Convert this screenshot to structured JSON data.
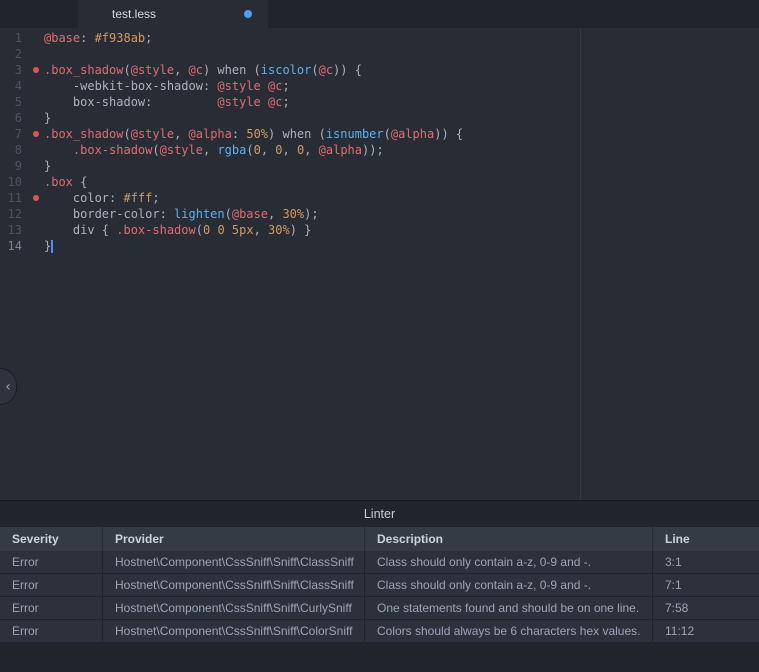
{
  "ui": {
    "colors": {
      "accent_blue": "#4f9cf7",
      "error_red": "#df5452",
      "cursor_blue": "#528bff"
    }
  },
  "tab": {
    "title": "test.less"
  },
  "editor": {
    "colors": {
      "fg": "#abb2bf",
      "red": "#e06c75",
      "orange": "#d19a66",
      "blue": "#61afef"
    },
    "lines": [
      {
        "num": "1",
        "segs": [
          [
            "red",
            "@base"
          ],
          [
            "fg",
            ": "
          ],
          [
            "orange",
            "#f938ab"
          ],
          [
            "fg",
            ";"
          ]
        ]
      },
      {
        "num": "2",
        "segs": []
      },
      {
        "num": "3",
        "dot": true,
        "segs": [
          [
            "red",
            ".box_shadow"
          ],
          [
            "fg",
            "("
          ],
          [
            "red",
            "@style"
          ],
          [
            "fg",
            ", "
          ],
          [
            "red",
            "@c"
          ],
          [
            "fg",
            ") when ("
          ],
          [
            "blue",
            "iscolor"
          ],
          [
            "fg",
            "("
          ],
          [
            "red",
            "@c"
          ],
          [
            "fg",
            ")) {"
          ]
        ]
      },
      {
        "num": "4",
        "segs": [
          [
            "fg",
            "    -webkit-box-shadow: "
          ],
          [
            "red",
            "@style"
          ],
          [
            "fg",
            " "
          ],
          [
            "red",
            "@c"
          ],
          [
            "fg",
            ";"
          ]
        ]
      },
      {
        "num": "5",
        "segs": [
          [
            "fg",
            "    box-shadow:         "
          ],
          [
            "red",
            "@style"
          ],
          [
            "fg",
            " "
          ],
          [
            "red",
            "@c"
          ],
          [
            "fg",
            ";"
          ]
        ]
      },
      {
        "num": "6",
        "segs": [
          [
            "fg",
            "}"
          ]
        ]
      },
      {
        "num": "7",
        "dot": true,
        "segs": [
          [
            "red",
            ".box_shadow"
          ],
          [
            "fg",
            "("
          ],
          [
            "red",
            "@style"
          ],
          [
            "fg",
            ", "
          ],
          [
            "red",
            "@alpha"
          ],
          [
            "fg",
            ": "
          ],
          [
            "orange",
            "50%"
          ],
          [
            "fg",
            ") when ("
          ],
          [
            "blue",
            "isnumber"
          ],
          [
            "fg",
            "("
          ],
          [
            "red",
            "@alpha"
          ],
          [
            "fg",
            ")) {"
          ]
        ]
      },
      {
        "num": "8",
        "segs": [
          [
            "fg",
            "    "
          ],
          [
            "red",
            ".box-shadow"
          ],
          [
            "fg",
            "("
          ],
          [
            "red",
            "@style"
          ],
          [
            "fg",
            ", "
          ],
          [
            "blue",
            "rgba"
          ],
          [
            "fg",
            "("
          ],
          [
            "orange",
            "0"
          ],
          [
            "fg",
            ", "
          ],
          [
            "orange",
            "0"
          ],
          [
            "fg",
            ", "
          ],
          [
            "orange",
            "0"
          ],
          [
            "fg",
            ", "
          ],
          [
            "red",
            "@alpha"
          ],
          [
            "fg",
            "));"
          ]
        ]
      },
      {
        "num": "9",
        "segs": [
          [
            "fg",
            "}"
          ]
        ]
      },
      {
        "num": "10",
        "segs": [
          [
            "red",
            ".box"
          ],
          [
            "fg",
            " {"
          ]
        ]
      },
      {
        "num": "11",
        "dot": true,
        "segs": [
          [
            "fg",
            "    color: "
          ],
          [
            "orange",
            "#fff"
          ],
          [
            "fg",
            ";"
          ]
        ]
      },
      {
        "num": "12",
        "segs": [
          [
            "fg",
            "    border-color: "
          ],
          [
            "blue",
            "lighten"
          ],
          [
            "fg",
            "("
          ],
          [
            "red",
            "@base"
          ],
          [
            "fg",
            ", "
          ],
          [
            "orange",
            "30%"
          ],
          [
            "fg",
            ");"
          ]
        ]
      },
      {
        "num": "13",
        "segs": [
          [
            "fg",
            "    div { "
          ],
          [
            "red",
            ".box-shadow"
          ],
          [
            "fg",
            "("
          ],
          [
            "orange",
            "0"
          ],
          [
            "fg",
            " "
          ],
          [
            "orange",
            "0"
          ],
          [
            "fg",
            " "
          ],
          [
            "orange",
            "5px"
          ],
          [
            "fg",
            ", "
          ],
          [
            "orange",
            "30%"
          ],
          [
            "fg",
            ") }"
          ]
        ]
      },
      {
        "num": "14",
        "active": true,
        "cursor": true,
        "segs": [
          [
            "fg",
            "}"
          ]
        ]
      }
    ]
  },
  "panel_toggle": {
    "icon": "‹"
  },
  "linter": {
    "title": "Linter",
    "columns": [
      "Severity",
      "Provider",
      "Description",
      "Line"
    ],
    "rows": [
      {
        "severity": "Error",
        "provider": "Hostnet\\Component\\CssSniff\\Sniff\\ClassSniff",
        "description": "Class should only contain a-z, 0-9 and -.",
        "line": "3:1"
      },
      {
        "severity": "Error",
        "provider": "Hostnet\\Component\\CssSniff\\Sniff\\ClassSniff",
        "description": "Class should only contain a-z, 0-9 and -.",
        "line": "7:1"
      },
      {
        "severity": "Error",
        "provider": "Hostnet\\Component\\CssSniff\\Sniff\\CurlySniff",
        "description": "One statements found and should be on one line.",
        "line": "7:58"
      },
      {
        "severity": "Error",
        "provider": "Hostnet\\Component\\CssSniff\\Sniff\\ColorSniff",
        "description": "Colors should always be 6 characters hex values.",
        "line": "11:12"
      }
    ]
  }
}
